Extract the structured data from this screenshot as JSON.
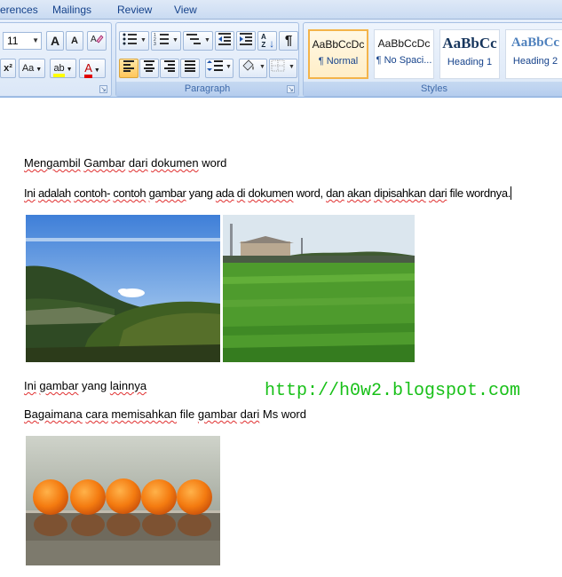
{
  "ribbon": {
    "tabs": [
      {
        "label": "erences"
      },
      {
        "label": "Mailings"
      },
      {
        "label": "Review"
      },
      {
        "label": "View"
      }
    ],
    "font": {
      "size_value": "11",
      "grow_label": "A",
      "shrink_label": "A",
      "superscript_label": "x²",
      "case_label": "Aa",
      "highlight_label": "ab",
      "font_color_label": "A",
      "highlight_color": "#ffff00",
      "font_color": "#e00000"
    },
    "paragraph": {
      "label": "Paragraph",
      "sort_label": "A Z",
      "pilcrow": "¶"
    },
    "styles": {
      "label": "Styles",
      "items": [
        {
          "sample": "AaBbCcDc",
          "name": "¶ Normal",
          "selected": true
        },
        {
          "sample": "AaBbCcDc",
          "name": "¶ No Spaci..."
        },
        {
          "sample": "AaBbCc",
          "name": "Heading 1"
        },
        {
          "sample": "AaBbCc",
          "name": "Heading 2"
        }
      ]
    }
  },
  "document": {
    "line1": {
      "w1": "Mengambil",
      "sp1": " ",
      "w2": "Gambar",
      "sp2": " ",
      "w3": "dari",
      "sp3": " ",
      "w4": "dokumen",
      "rest": " word"
    },
    "line2": {
      "w1": "Ini",
      "sp1": " ",
      "w2": "adalah",
      "sp2": " ",
      "w3": "contoh-",
      "sp3": " ",
      "w4": "contoh",
      "sp4": " ",
      "w5": "gambar",
      "mid1": " yang ",
      "w6": "ada",
      "sp6": " ",
      "w7": "di",
      "sp7": " ",
      "w8": "dokumen",
      "mid2": " word, ",
      "w9": "dan",
      "sp9": " ",
      "w10": "akan",
      "sp10": " ",
      "w11": "dipisahkan",
      "sp11": " ",
      "w12": "dari",
      "rest": " file wordnya."
    },
    "line3": {
      "w1": "Ini",
      "sp1": " ",
      "w2": "gambar",
      "mid": " yang ",
      "w3": "lainnya"
    },
    "line4": {
      "w1": "Bagaimana",
      "sp1": " ",
      "w2": "cara",
      "sp2": " ",
      "w3": "memisahkan",
      "mid": " file ",
      "w4": "gambar",
      "sp4": " ",
      "w5": "dari",
      "rest": " Ms word"
    },
    "watermark": "http://h0w2.blogspot.com"
  }
}
